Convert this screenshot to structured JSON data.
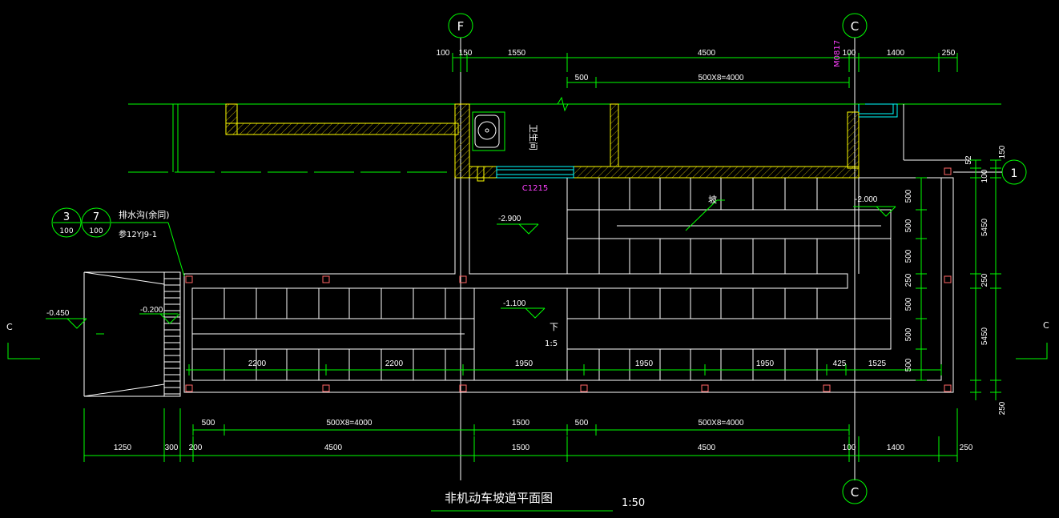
{
  "axes": {
    "f_top": "F",
    "c_top": "C",
    "c_bottom": "C",
    "one_right": "1"
  },
  "section_marks": {
    "left": "C",
    "right": "C"
  },
  "callout": {
    "num1": "3",
    "den1": "100",
    "num2": "7",
    "den2": "100",
    "title": "排水沟(余同)",
    "ref": "参12YJ9-1"
  },
  "labels": {
    "room": "卫生间",
    "window": "C1215",
    "door": "M0817",
    "up_down": "下",
    "slope_ratio": "1:5",
    "ramp_dir": "坡"
  },
  "elevations": {
    "e1": "-2.900",
    "e2": "-2.000",
    "e3": "-1.100",
    "e4": "-0.450",
    "e5": "-0.200"
  },
  "title": {
    "main": "非机动车坡道平面图",
    "scale": "1:50"
  },
  "dims": {
    "top1": [
      "100",
      "150",
      "1550",
      "4500",
      "100",
      "1400",
      "250"
    ],
    "top2": [
      "500",
      "500X8=4000"
    ],
    "inner_row": [
      "2200",
      "2200",
      "1950",
      "1950",
      "1950",
      "425",
      "1525"
    ],
    "bottom1": [
      "500",
      "500X8=4000",
      "1500",
      "500",
      "500X8=4000"
    ],
    "bottom2": [
      "1250",
      "300",
      "200",
      "4500",
      "1500",
      "4500",
      "100",
      "1400",
      "250"
    ],
    "right_col1": [
      "500",
      "500",
      "500",
      "250",
      "500",
      "500",
      "500"
    ],
    "right_col2": [
      "100",
      "5450",
      "250",
      "5450"
    ],
    "right_edge": [
      "150",
      "250"
    ],
    "tag_52": "52"
  }
}
